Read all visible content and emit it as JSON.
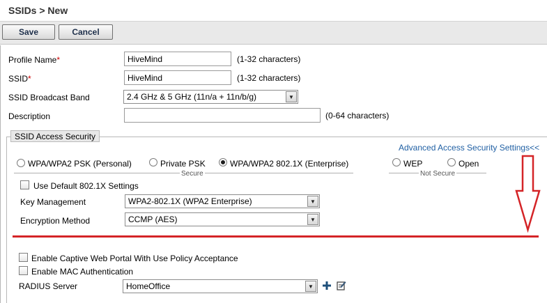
{
  "header": {
    "title": "SSIDs > New"
  },
  "toolbar": {
    "save_label": "Save",
    "cancel_label": "Cancel"
  },
  "form": {
    "profile_name": {
      "label": "Profile Name",
      "required_mark": "*",
      "value": "HiveMind",
      "hint": "(1-32 characters)"
    },
    "ssid": {
      "label": "SSID",
      "required_mark": "*",
      "value": "HiveMind",
      "hint": "(1-32 characters)"
    },
    "broadcast_band": {
      "label": "SSID Broadcast Band",
      "selected": "2.4 GHz & 5 GHz (11n/a + 11n/b/g)"
    },
    "description": {
      "label": "Description",
      "value": "",
      "hint": "(0-64 characters)"
    }
  },
  "security": {
    "legend": "SSID Access Security",
    "advanced_link": "Advanced Access Security Settings<<",
    "secure_caption": "Secure",
    "not_secure_caption": "Not Secure",
    "options": [
      {
        "label": "WPA/WPA2 PSK (Personal)",
        "selected": false
      },
      {
        "label": "Private PSK",
        "selected": false
      },
      {
        "label": "WPA/WPA2 802.1X (Enterprise)",
        "selected": true
      },
      {
        "label": "WEP",
        "selected": false
      },
      {
        "label": "Open",
        "selected": false
      }
    ],
    "use_default_label": "Use Default 802.1X Settings",
    "key_management": {
      "label": "Key Management",
      "selected": "WPA2-802.1X (WPA2 Enterprise)"
    },
    "encryption_method": {
      "label": "Encryption Method",
      "selected": "CCMP (AES)"
    },
    "captive_portal_label": "Enable Captive Web Portal With Use Policy Acceptance",
    "mac_auth_label": "Enable MAC Authentication",
    "radius": {
      "label": "RADIUS Server",
      "selected": "HomeOffice"
    }
  },
  "colors": {
    "annotation_red": "#d42427",
    "link_blue": "#1f5fa3",
    "required_red": "#cc0000"
  }
}
